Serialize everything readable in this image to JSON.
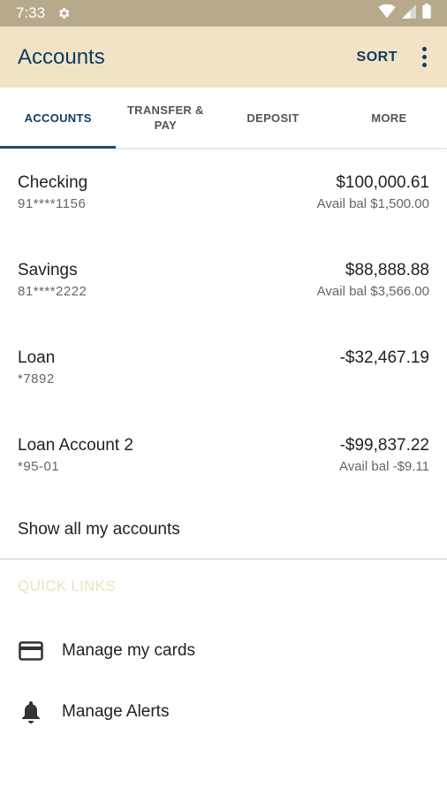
{
  "status_bar": {
    "time": "7:33",
    "icons": [
      "gear-icon",
      "wifi-icon",
      "signal-icon",
      "battery-icon"
    ]
  },
  "app_bar": {
    "title": "Accounts",
    "sort_label": "SORT",
    "menu_icon": "more-vert-icon",
    "background": "#f3e3c6",
    "accent": "#0e3d63"
  },
  "tabs": [
    {
      "label": "ACCOUNTS",
      "active": true
    },
    {
      "label": "TRANSFER & PAY",
      "active": false
    },
    {
      "label": "DEPOSIT",
      "active": false
    },
    {
      "label": "MORE",
      "active": false
    }
  ],
  "accounts": [
    {
      "name": "Checking",
      "number": "91****1156",
      "balance": "$100,000.61",
      "available": "Avail bal $1,500.00"
    },
    {
      "name": "Savings",
      "number": "81****2222",
      "balance": "$88,888.88",
      "available": "Avail bal $3,566.00"
    },
    {
      "name": "Loan",
      "number": "*7892",
      "balance": "-$32,467.19",
      "available": ""
    },
    {
      "name": "Loan Account 2",
      "number": "*95-01",
      "balance": "-$99,837.22",
      "available": "Avail bal -$9.11"
    }
  ],
  "show_all_label": "Show all my accounts",
  "quick_links": {
    "title": "QUICK LINKS",
    "items": [
      {
        "label": "Manage my cards",
        "icon": "credit-card-icon"
      },
      {
        "label": "Manage Alerts",
        "icon": "bell-icon"
      }
    ]
  }
}
